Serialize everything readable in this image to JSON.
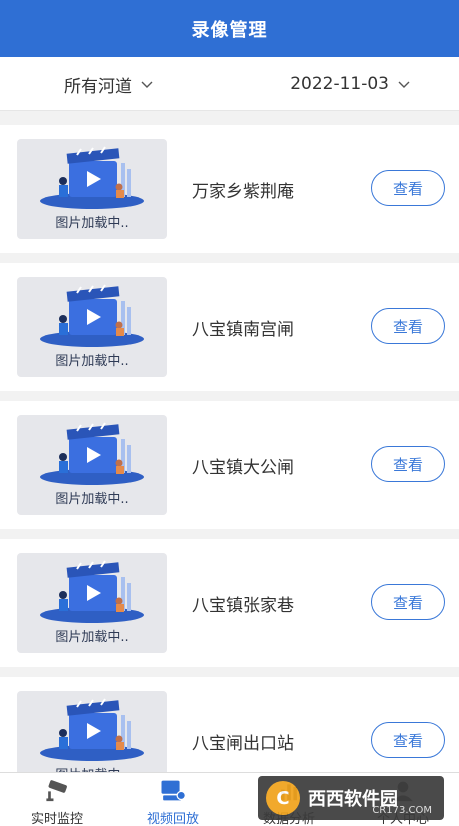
{
  "header": {
    "title": "录像管理"
  },
  "filters": {
    "river": "所有河道",
    "date": "2022-11-03"
  },
  "items": [
    {
      "thumbnail_text": "图片加载中..",
      "station": "万家乡紫荆庵",
      "button": "查看"
    },
    {
      "thumbnail_text": "图片加载中..",
      "station": "八宝镇南宫闸",
      "button": "查看"
    },
    {
      "thumbnail_text": "图片加载中..",
      "station": "八宝镇大公闸",
      "button": "查看"
    },
    {
      "thumbnail_text": "图片加载中..",
      "station": "八宝镇张家巷",
      "button": "查看"
    },
    {
      "thumbnail_text": "图片加载中..",
      "station": "八宝闸出口站",
      "button": "查看"
    }
  ],
  "tabbar": {
    "tabs": [
      {
        "label": "实时监控",
        "icon": "camera-icon"
      },
      {
        "label": "视频回放",
        "icon": "video-playback-icon",
        "active": true
      },
      {
        "label": "数据分析",
        "icon": "chart-icon"
      },
      {
        "label": "个人中心",
        "icon": "user-icon"
      }
    ]
  },
  "watermark": {
    "name": "西西软件园",
    "url": "CR173.COM"
  },
  "colors": {
    "primary": "#2f6fd4",
    "button_border": "#3a78d8"
  }
}
